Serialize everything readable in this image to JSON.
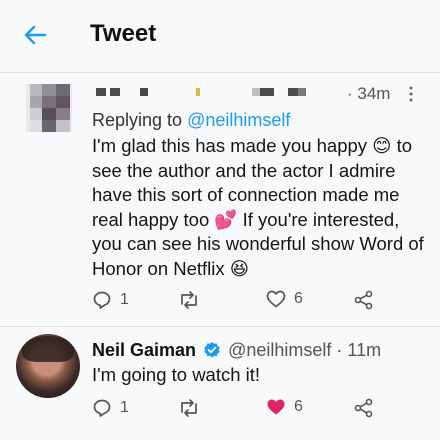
{
  "header": {
    "title": "Tweet",
    "back_icon": "arrow-left-icon"
  },
  "colors": {
    "accent": "#1d9bf0",
    "like": "#e0245e",
    "muted": "#555555"
  },
  "tweets": [
    {
      "time": "34m",
      "reply_prefix": "Replying to",
      "reply_handle": "@neilhimself",
      "body_lines": [
        "I'm glad this has made you happy 😊 to",
        "see the author and the actor I admire",
        "have this sort of connection made me",
        "real happy too 💕 If you're interested,",
        "you can see his wonderful show Word of",
        "Honor on Netflix 😆"
      ],
      "replies": "1",
      "likes": "6"
    },
    {
      "name": "Neil Gaiman",
      "handle": "@neilhimself",
      "time": "11m",
      "body": "I'm going to watch it!",
      "replies": "1",
      "likes": "6"
    }
  ]
}
